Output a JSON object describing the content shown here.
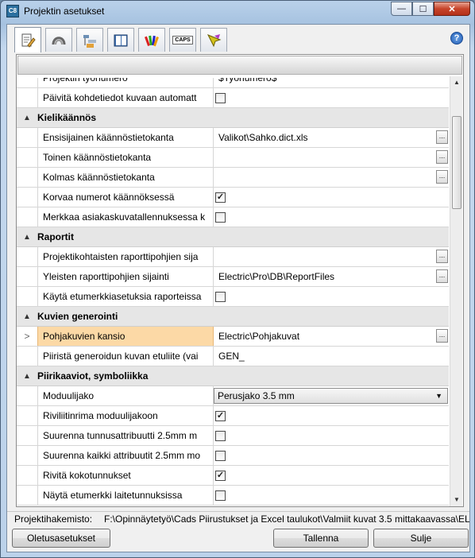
{
  "window": {
    "title": "Projektin asetukset"
  },
  "title_buttons": {
    "minimize": "—",
    "maximize": "☐",
    "close": "✕"
  },
  "toolbar_tabs": [
    {
      "icon": "settings-edit-icon"
    },
    {
      "icon": "cable-icon"
    },
    {
      "icon": "hierarchy-icon"
    },
    {
      "icon": "book-icon"
    },
    {
      "icon": "palette-icon"
    },
    {
      "icon": "caps-icon",
      "text": "CAPS"
    },
    {
      "icon": "cursor-color-icon"
    }
  ],
  "help_glyph": "?",
  "partial_rows": [
    {
      "name": "Projektin työnumero",
      "value": "$Työnumero$"
    },
    {
      "name": "Päivitä kohdetiedot kuvaan automatt",
      "checked": false
    }
  ],
  "categories": [
    {
      "label": "Kielikäännös",
      "rows": [
        {
          "name": "Ensisijainen käännöstietokanta",
          "value": "Valikot\\Sahko.dict.xls",
          "ellipsis": true
        },
        {
          "name": "Toinen käännöstietokanta",
          "value": "",
          "ellipsis": true
        },
        {
          "name": "Kolmas käännöstietokanta",
          "value": "",
          "ellipsis": true
        },
        {
          "name": "Korvaa numerot käännöksessä",
          "checked": true
        },
        {
          "name": "Merkkaa asiakaskuvatallennuksessa k",
          "checked": false
        }
      ]
    },
    {
      "label": "Raportit",
      "rows": [
        {
          "name": "Projektikohtaisten raporttipohjien sija",
          "value": "",
          "ellipsis": true
        },
        {
          "name": "Yleisten raporttipohjien sijainti",
          "value": "Electric\\Pro\\DB\\ReportFiles",
          "ellipsis": true
        },
        {
          "name": "Käytä etumerkkiasetuksia raporteissa",
          "checked": false
        }
      ]
    },
    {
      "label": "Kuvien generointi",
      "rows": [
        {
          "name": "Pohjakuvien kansio",
          "value": "Electric\\Pohjakuvat",
          "ellipsis": true,
          "selected": true,
          "marker": ">"
        },
        {
          "name": "Piiristä generoidun kuvan etuliite (vai",
          "value": "GEN_"
        }
      ]
    },
    {
      "label": "Piirikaaviot, symboliikka",
      "rows": [
        {
          "name": "Moduulijako",
          "dropdown": "Perusjako 3.5 mm"
        },
        {
          "name": "Riviliitinrima moduulijakoon",
          "checked": true
        },
        {
          "name": "Suurenna tunnusattribuutti 2.5mm m",
          "checked": false
        },
        {
          "name": "Suurenna kaikki attribuutit 2.5mm mo",
          "checked": false
        },
        {
          "name": "Rivitä kokotunnukset",
          "checked": true
        },
        {
          "name": "Näytä etumerkki laitetunnuksissa",
          "checked": false
        }
      ]
    }
  ],
  "status": {
    "label": "Projektihakemisto:",
    "path": "F:\\Opinnäytetyö\\Cads Piirustukset ja Excel taulukot\\Valmiit kuvat 3.5 mittakaavassa\\EL"
  },
  "buttons": {
    "defaults": "Oletusasetukset",
    "save": "Tallenna",
    "close": "Sulje"
  },
  "colors": {
    "selected_row": "#fcd9a6",
    "category_bg": "#e6e6e6",
    "title_gradient": "#b9d1ea",
    "close_button": "#c7442a"
  }
}
